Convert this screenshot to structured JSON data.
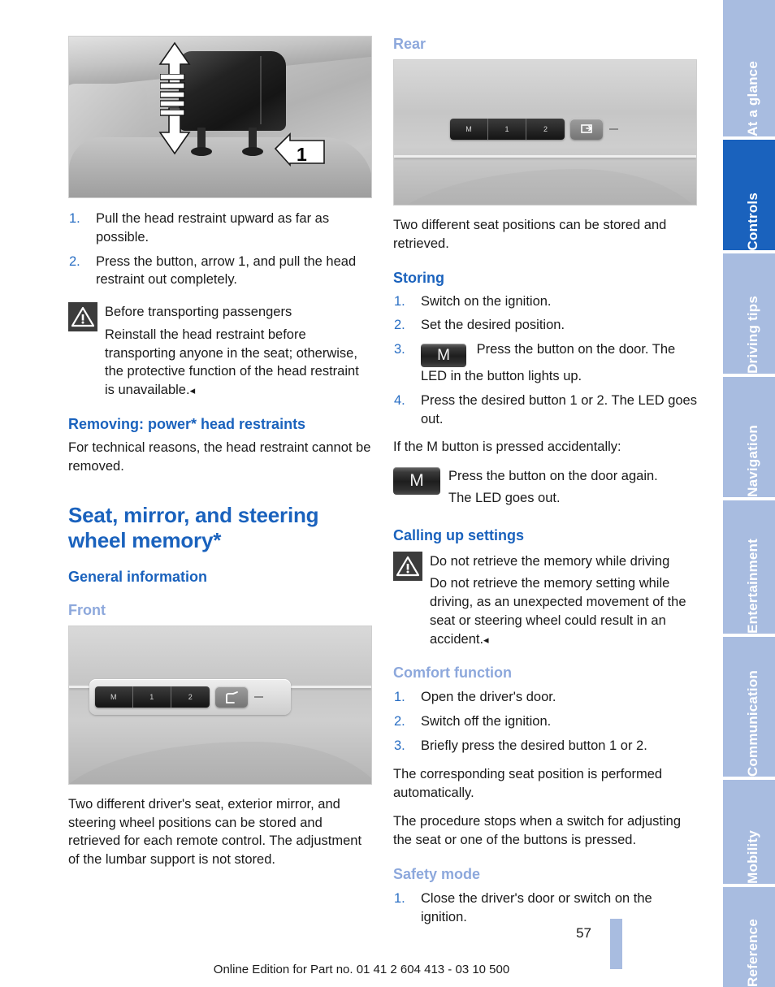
{
  "document": {
    "page_number": "57",
    "footer": "Online Edition for Part no. 01 41 2 604 413 - 03 10 500"
  },
  "sidebar": {
    "tabs": [
      {
        "label": "At a glance",
        "active": false
      },
      {
        "label": "Controls",
        "active": true
      },
      {
        "label": "Driving tips",
        "active": false
      },
      {
        "label": "Navigation",
        "active": false
      },
      {
        "label": "Entertainment",
        "active": false
      },
      {
        "label": "Communication",
        "active": false
      },
      {
        "label": "Mobility",
        "active": false
      },
      {
        "label": "Reference",
        "active": false
      }
    ]
  },
  "left_column": {
    "headrest_figure": {
      "caption_number": "1",
      "alt": "Rear seat head restraint with up-down adjustment arrow and callout 1"
    },
    "removal_steps": [
      {
        "num": "1.",
        "text": "Pull the head restraint upward as far as possible."
      },
      {
        "num": "2.",
        "text": "Press the button, arrow 1, and pull the head restraint out completely."
      }
    ],
    "warning": {
      "icon": "warning-triangle-icon",
      "title": "Before transporting passengers",
      "body": "Reinstall the head restraint before transporting anyone in the seat; otherwise, the protective function of the head restraint is unavailable.",
      "end_mark": "◂"
    },
    "removing_power": {
      "heading": "Removing: power* head restraints",
      "body": "For technical reasons, the head restraint cannot be removed."
    },
    "chapter_title": "Seat, mirror, and steering wheel memory*",
    "general_information_heading": "General information",
    "front_heading": "Front",
    "front_figure": {
      "alt": "Driver's door memory panel with M, 1, 2 buttons and seat adjust button",
      "keys": [
        "M",
        "1",
        "2"
      ],
      "function_icon": "seat-memory-icon"
    },
    "front_body": "Two different driver's seat, exterior mirror, and steering wheel positions can be stored and retrieved for each remote control. The adjustment of the lumbar support is not stored."
  },
  "right_column": {
    "rear_heading": "Rear",
    "rear_figure": {
      "alt": "Rear door memory panel with M, 1, 2 buttons and seat backrest button",
      "keys": [
        "M",
        "1",
        "2"
      ],
      "function_icon": "seat-backrest-icon"
    },
    "rear_body": "Two different seat positions can be stored and retrieved.",
    "storing": {
      "heading": "Storing",
      "steps": [
        {
          "num": "1.",
          "text": "Switch on the ignition."
        },
        {
          "num": "2.",
          "text": "Set the desired position."
        },
        {
          "num": "3.",
          "button": "M",
          "text": "Press the button on the door. The LED in the button lights up."
        },
        {
          "num": "4.",
          "text": "Press the desired button 1 or 2. The LED goes out."
        }
      ],
      "note": "If the M button is pressed accidentally:",
      "accidental": {
        "button": "M",
        "line1": "Press the button on the door again.",
        "line2": "The LED goes out."
      }
    },
    "calling_up": {
      "heading": "Calling up settings",
      "warning": {
        "icon": "warning-triangle-icon",
        "title": "Do not retrieve the memory while driving",
        "body": "Do not retrieve the memory setting while driving, as an unexpected movement of the seat or steering wheel could result in an accident.",
        "end_mark": "◂"
      }
    },
    "comfort": {
      "heading": "Comfort function",
      "steps": [
        {
          "num": "1.",
          "text": "Open the driver's door."
        },
        {
          "num": "2.",
          "text": "Switch off the ignition."
        },
        {
          "num": "3.",
          "text": "Briefly press the desired button 1 or 2."
        }
      ],
      "body1": "The corresponding seat position is performed automatically.",
      "body2": "The procedure stops when a switch for adjusting the seat or one of the buttons is pressed."
    },
    "safety_mode": {
      "heading": "Safety mode",
      "steps": [
        {
          "num": "1.",
          "text": "Close the driver's door or switch on the ignition."
        }
      ]
    }
  },
  "colors": {
    "heading_blue": "#1a62bd",
    "subheading_blue": "#8da8dc",
    "tab_inactive": "#a8bce0",
    "tab_active": "#1a62bd"
  }
}
